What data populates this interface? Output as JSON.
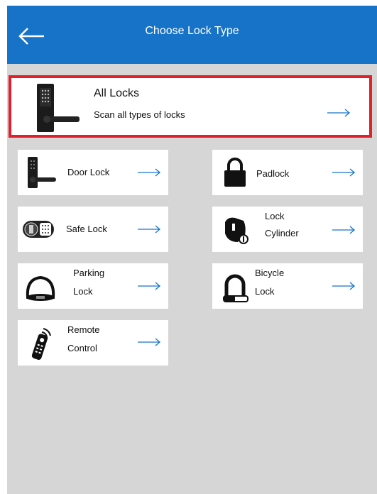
{
  "header": {
    "title": "Choose Lock Type",
    "back_icon": "arrow-left-icon"
  },
  "featured": {
    "title": "All Locks",
    "subtitle": "Scan all types of locks",
    "icon": "smart-door-lock-icon",
    "highlight_color": "#e0202a"
  },
  "lock_types": [
    {
      "line1": "Door Lock",
      "line2": "",
      "icon": "door-lock-icon"
    },
    {
      "line1": "Padlock",
      "line2": "",
      "icon": "padlock-icon"
    },
    {
      "line1": "Safe Lock",
      "line2": "",
      "icon": "safe-lock-icon"
    },
    {
      "line1": "Lock",
      "line2": "Cylinder",
      "icon": "lock-cylinder-icon"
    },
    {
      "line1": "Parking",
      "line2": "Lock",
      "icon": "parking-lock-icon"
    },
    {
      "line1": "Bicycle",
      "line2": "Lock",
      "icon": "bicycle-lock-icon"
    },
    {
      "line1": "Remote",
      "line2": "Control",
      "icon": "remote-control-icon"
    }
  ],
  "colors": {
    "accent": "#1773c8",
    "background": "#d6d6d6"
  }
}
